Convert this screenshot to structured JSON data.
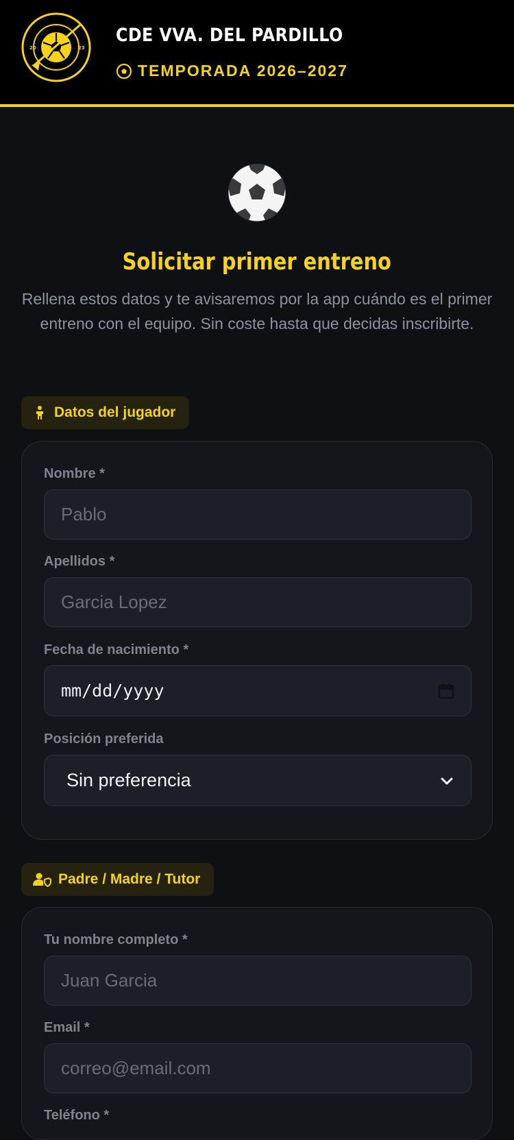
{
  "header": {
    "logo_text_top": "C.D.E. VILLANUEVA",
    "logo_text_bottom": "DEL PARDILLO",
    "logo_year_left": "20",
    "logo_year_right": "23",
    "club_name": "CDE VVA. DEL PARDILLO",
    "season": "TEMPORADA 2026–2027",
    "season_icon": "soccer-ball-icon",
    "accent_color": "#f5d318"
  },
  "hero": {
    "icon": "soccer-ball-icon",
    "title": "Solicitar primer entreno",
    "intro": "Rellena estos datos y te avisaremos por la app cuándo es el primer entreno con el equipo. Sin coste hasta que decidas inscribirte."
  },
  "player_section": {
    "chip_icon": "child-icon",
    "chip_label": "Datos del jugador",
    "fields": {
      "first_name": {
        "label": "Nombre *",
        "placeholder": "Pablo"
      },
      "last_name": {
        "label": "Apellidos *",
        "placeholder": "Garcia Lopez"
      },
      "birth_date": {
        "label": "Fecha de nacimiento *",
        "placeholder": "mm/dd/yyyy"
      },
      "position": {
        "label": "Posición preferida",
        "value": "Sin preferencia"
      }
    }
  },
  "guardian_section": {
    "chip_icon": "user-shield-icon",
    "chip_label": "Padre / Madre / Tutor",
    "fields": {
      "full_name": {
        "label": "Tu nombre completo *",
        "placeholder": "Juan Garcia"
      },
      "email": {
        "label": "Email *",
        "placeholder": "correo@email.com"
      },
      "phone": {
        "label": "Teléfono *"
      }
    }
  }
}
